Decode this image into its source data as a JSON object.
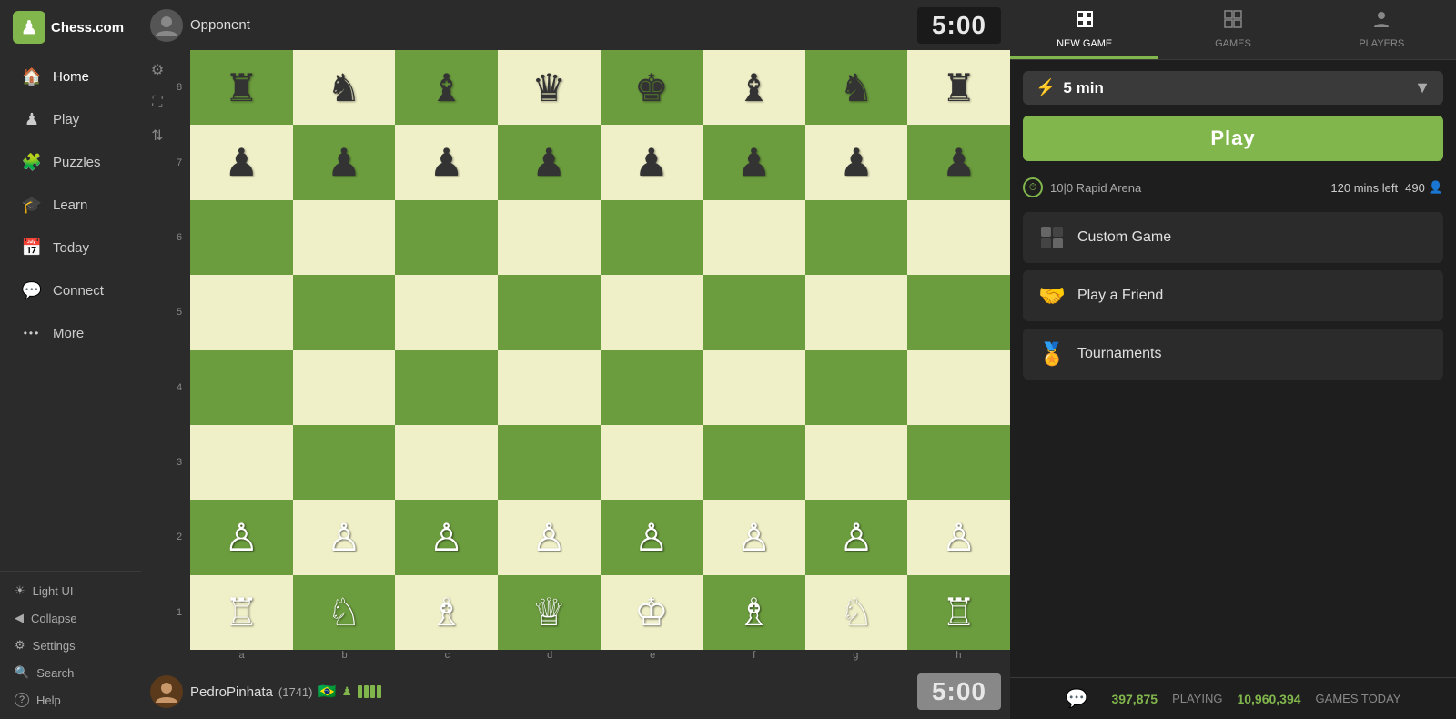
{
  "logo": {
    "text": "Chess.com"
  },
  "sidebar": {
    "nav_items": [
      {
        "id": "home",
        "label": "Home",
        "icon": "🏠"
      },
      {
        "id": "play",
        "label": "Play",
        "icon": "♟"
      },
      {
        "id": "puzzles",
        "label": "Puzzles",
        "icon": "🧩"
      },
      {
        "id": "learn",
        "label": "Learn",
        "icon": "🎓"
      },
      {
        "id": "today",
        "label": "Today",
        "icon": "📅"
      },
      {
        "id": "connect",
        "label": "Connect",
        "icon": "💬"
      },
      {
        "id": "more",
        "label": "More",
        "icon": "···"
      }
    ],
    "bottom_items": [
      {
        "id": "light-ui",
        "label": "Light UI",
        "icon": "☀"
      },
      {
        "id": "collapse",
        "label": "Collapse",
        "icon": "◀"
      },
      {
        "id": "settings",
        "label": "Settings",
        "icon": "⚙"
      },
      {
        "id": "search",
        "label": "Search",
        "icon": "🔍"
      },
      {
        "id": "help",
        "label": "Help",
        "icon": "?"
      }
    ]
  },
  "game": {
    "opponent_name": "Opponent",
    "opponent_timer": "5:00",
    "player_name": "PedroPinhata",
    "player_rating": "1741",
    "player_timer": "5:00",
    "player_flag": "🇧🇷"
  },
  "board": {
    "rank_labels": [
      "8",
      "7",
      "6",
      "5",
      "4",
      "3",
      "2",
      "1"
    ],
    "file_labels": [
      "a",
      "b",
      "c",
      "d",
      "e",
      "f",
      "g",
      "h"
    ],
    "pieces": {
      "a8": "♜",
      "b8": "♞",
      "c8": "♝",
      "d8": "♛",
      "e8": "♚",
      "f8": "♝",
      "g8": "♞",
      "h8": "♜",
      "a7": "♟",
      "b7": "♟",
      "c7": "♟",
      "d7": "♟",
      "e7": "♟",
      "f7": "♟",
      "g7": "♟",
      "h7": "♟",
      "a2": "♙",
      "b2": "♙",
      "c2": "♙",
      "d2": "♙",
      "e2": "♙",
      "f2": "♙",
      "g2": "♙",
      "h2": "♙",
      "a1": "♖",
      "b1": "♘",
      "c1": "♗",
      "d1": "♕",
      "e1": "♔",
      "f1": "♗",
      "g1": "♘",
      "h1": "♖"
    }
  },
  "panel": {
    "tabs": [
      {
        "id": "new-game",
        "label": "NEW GAME",
        "icon": "+"
      },
      {
        "id": "games",
        "label": "GAMES",
        "icon": "⊞"
      },
      {
        "id": "players",
        "label": "PLAYERS",
        "icon": "👤"
      }
    ],
    "time_control": "5 min",
    "play_label": "Play",
    "arena": {
      "name": "10|0 Rapid Arena",
      "time_left": "120 mins left",
      "players": "490"
    },
    "options": [
      {
        "id": "custom-game",
        "label": "Custom Game",
        "icon": "🎲"
      },
      {
        "id": "play-friend",
        "label": "Play a Friend",
        "icon": "🤝"
      },
      {
        "id": "tournaments",
        "label": "Tournaments",
        "icon": "🏅"
      }
    ],
    "stats": {
      "playing_count": "397,875",
      "playing_label": "PLAYING",
      "games_today_count": "10,960,394",
      "games_today_label": "GAMES TODAY"
    }
  }
}
